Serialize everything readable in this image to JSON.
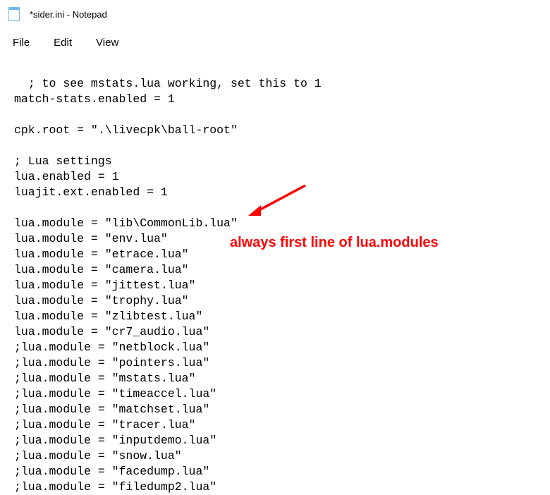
{
  "window": {
    "title": "*sider.ini - Notepad"
  },
  "menu": {
    "file": "File",
    "edit": "Edit",
    "view": "View"
  },
  "editor": {
    "content": "; to see mstats.lua working, set this to 1\nmatch-stats.enabled = 1\n\ncpk.root = \".\\livecpk\\ball-root\"\n\n; Lua settings\nlua.enabled = 1\nluajit.ext.enabled = 1\n\nlua.module = \"lib\\CommonLib.lua\"\nlua.module = \"env.lua\"\nlua.module = \"etrace.lua\"\nlua.module = \"camera.lua\"\nlua.module = \"jittest.lua\"\nlua.module = \"trophy.lua\"\nlua.module = \"zlibtest.lua\"\nlua.module = \"cr7_audio.lua\"\n;lua.module = \"netblock.lua\"\n;lua.module = \"pointers.lua\"\n;lua.module = \"mstats.lua\"\n;lua.module = \"timeaccel.lua\"\n;lua.module = \"matchset.lua\"\n;lua.module = \"tracer.lua\"\n;lua.module = \"inputdemo.lua\"\n;lua.module = \"snow.lua\"\n;lua.module = \"facedump.lua\"\n;lua.module = \"filedump2.lua\""
  },
  "annotation": {
    "text": "always first line of lua.modules"
  }
}
